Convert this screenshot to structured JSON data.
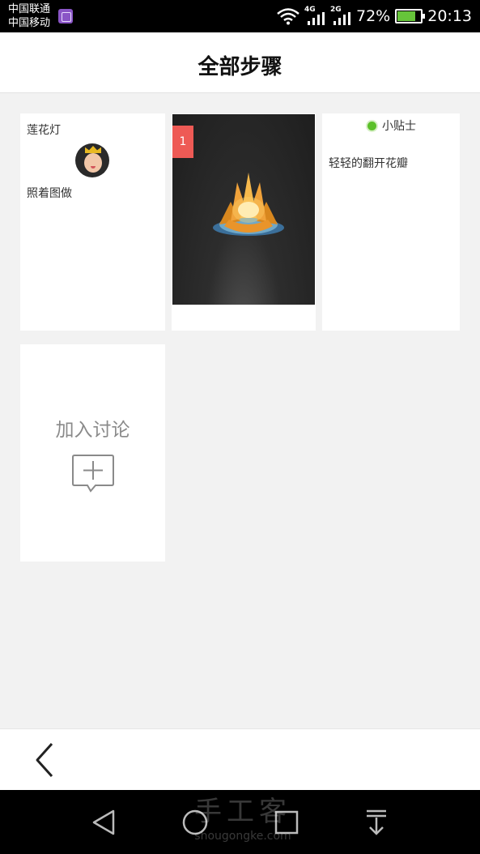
{
  "status_bar": {
    "carrier_1": "中国联通",
    "carrier_2": "中国移动",
    "network_1": "4G",
    "network_2": "2G",
    "battery": "72%",
    "time": "20:13"
  },
  "header": {
    "title": "全部步骤"
  },
  "intro_card": {
    "title": "莲花灯",
    "description": "照着图做"
  },
  "step_card": {
    "step_number": "1"
  },
  "tip_card": {
    "label": "小贴士",
    "text": "轻轻的翻开花瓣"
  },
  "discuss_card": {
    "label": "加入讨论"
  },
  "watermark": {
    "cn": "手工客",
    "en": "shougongke.com"
  },
  "colors": {
    "badge": "#ee5a55",
    "tip_dot": "#5cc02a",
    "battery_fill": "#66c43a"
  }
}
